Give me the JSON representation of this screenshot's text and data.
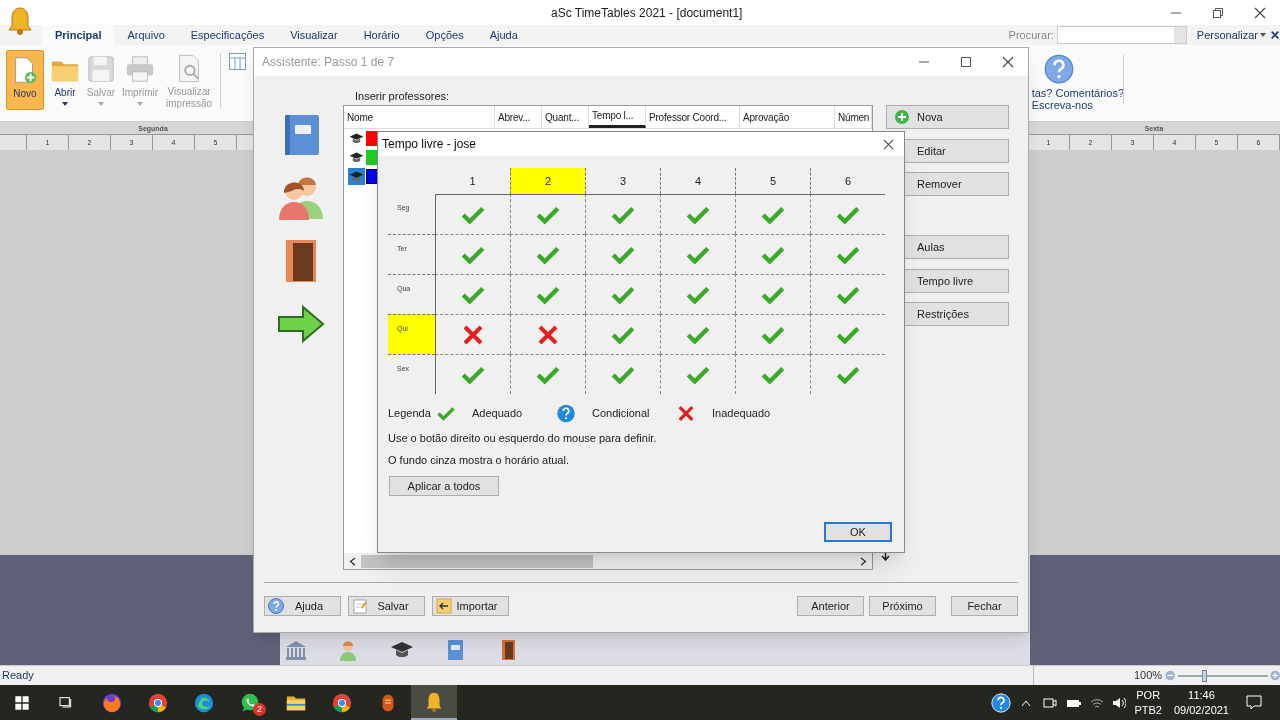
{
  "window": {
    "title": "aSc TimeTables 2021 - [document1]"
  },
  "ribbon": {
    "tabs": [
      {
        "label": "Principal",
        "selected": true
      },
      {
        "label": "Arquivo",
        "selected": false
      },
      {
        "label": "Especificações",
        "selected": false
      },
      {
        "label": "Visualizar",
        "selected": false
      },
      {
        "label": "Horário",
        "selected": false
      },
      {
        "label": "Opções",
        "selected": false
      },
      {
        "label": "Ajuda",
        "selected": false
      }
    ],
    "search_label": "Procurar:",
    "customize": "Personalizar",
    "buttons": [
      {
        "kind": "new",
        "label": "Novo",
        "selected": true,
        "disabled": false,
        "dropdown": false
      },
      {
        "kind": "open",
        "label": "Abrir",
        "selected": false,
        "disabled": false,
        "dropdown": true
      },
      {
        "kind": "save",
        "label": "Salvar",
        "selected": false,
        "disabled": true,
        "dropdown": true
      },
      {
        "kind": "print",
        "label": "Imprimir",
        "selected": false,
        "disabled": true,
        "dropdown": true
      },
      {
        "kind": "preview",
        "label": "Visualizar impressão",
        "selected": false,
        "disabled": true,
        "dropdown": false
      }
    ],
    "feedback": [
      "tas? Comentários?",
      "Escreva-nos"
    ]
  },
  "timetable": {
    "left": {
      "day": "Segunda",
      "periods": [
        "1",
        "2",
        "3",
        "4",
        "5"
      ]
    },
    "right": {
      "day": "Sexta",
      "periods": [
        "1",
        "2",
        "3",
        "4",
        "5",
        "6"
      ]
    }
  },
  "wizard": {
    "title": "Assistente: Passo 1 de 7",
    "label": "Inserir professores:",
    "columns": [
      {
        "label": "Nome",
        "selected": false
      },
      {
        "label": "Abrev...",
        "selected": false
      },
      {
        "label": "Quant...",
        "selected": false
      },
      {
        "label": "Tempo l...",
        "selected": true
      },
      {
        "label": "Professor Coord...",
        "selected": false
      },
      {
        "label": "Aprovação",
        "selected": false
      },
      {
        "label": "Númen",
        "selected": false
      }
    ],
    "rows": [
      {
        "color": "#ff0000",
        "selected": false
      },
      {
        "color": "#22cc22",
        "selected": false
      },
      {
        "color": "#0000ff",
        "selected": true
      }
    ],
    "side_buttons": [
      {
        "kind": "add",
        "label": "Nova"
      },
      {
        "kind": "plain",
        "label": "Editar"
      },
      {
        "kind": "plain",
        "label": "Remover"
      },
      {
        "kind": "plain",
        "label": "Aulas"
      },
      {
        "kind": "plain",
        "label": "Tempo livre"
      },
      {
        "kind": "plain",
        "label": "Restrições"
      }
    ],
    "footer_left": [
      {
        "kind": "help",
        "label": "Ajuda"
      },
      {
        "kind": "save",
        "label": "Salvar"
      },
      {
        "kind": "import",
        "label": "Importar"
      }
    ],
    "footer_right": [
      "Anterior",
      "Próximo",
      "Fechar"
    ]
  },
  "free_time_dialog": {
    "title": "Tempo livre - jose",
    "periods": [
      {
        "label": "1",
        "selected": false
      },
      {
        "label": "2",
        "selected": true
      },
      {
        "label": "3",
        "selected": false
      },
      {
        "label": "4",
        "selected": false
      },
      {
        "label": "5",
        "selected": false
      },
      {
        "label": "6",
        "selected": false
      }
    ],
    "days": [
      {
        "label": "Seg",
        "selected": false,
        "cells": [
          {
            "kind": "ok"
          },
          {
            "kind": "ok"
          },
          {
            "kind": "ok"
          },
          {
            "kind": "ok"
          },
          {
            "kind": "ok"
          },
          {
            "kind": "ok"
          }
        ]
      },
      {
        "label": "Ter",
        "selected": false,
        "cells": [
          {
            "kind": "ok"
          },
          {
            "kind": "ok"
          },
          {
            "kind": "ok"
          },
          {
            "kind": "ok"
          },
          {
            "kind": "ok"
          },
          {
            "kind": "ok"
          }
        ]
      },
      {
        "label": "Qua",
        "selected": false,
        "cells": [
          {
            "kind": "ok"
          },
          {
            "kind": "ok"
          },
          {
            "kind": "ok"
          },
          {
            "kind": "ok"
          },
          {
            "kind": "ok"
          },
          {
            "kind": "ok"
          }
        ]
      },
      {
        "label": "Qui",
        "selected": true,
        "cells": [
          {
            "kind": "no"
          },
          {
            "kind": "no"
          },
          {
            "kind": "ok"
          },
          {
            "kind": "ok"
          },
          {
            "kind": "ok"
          },
          {
            "kind": "ok"
          }
        ]
      },
      {
        "label": "Sex",
        "selected": false,
        "cells": [
          {
            "kind": "ok"
          },
          {
            "kind": "ok"
          },
          {
            "kind": "ok"
          },
          {
            "kind": "ok"
          },
          {
            "kind": "ok"
          },
          {
            "kind": "ok"
          }
        ]
      }
    ],
    "legend_label": "Legenda",
    "legend": [
      {
        "kind": "ok",
        "label": "Adequado"
      },
      {
        "kind": "maybe",
        "label": "Condicional"
      },
      {
        "kind": "no",
        "label": "Inadequado"
      }
    ],
    "notes": [
      "Use o botão direito ou esquerdo do mouse para definir.",
      "O fundo cinza mostra o horário atual."
    ],
    "apply_button": "Aplicar a todos",
    "ok_button": "OK"
  },
  "status_bar": {
    "text": "Ready",
    "zoom": "100%",
    "level": 0.28
  },
  "taskbar": {
    "apps": [
      {
        "kind": "start",
        "selected": false
      },
      {
        "kind": "taskview",
        "selected": false
      },
      {
        "kind": "fox",
        "selected": false
      },
      {
        "kind": "chrome",
        "selected": false
      },
      {
        "kind": "edge",
        "selected": false
      },
      {
        "kind": "chat",
        "selected": false,
        "badge": "2"
      },
      {
        "kind": "folder",
        "selected": false
      },
      {
        "kind": "chrome",
        "selected": false
      },
      {
        "kind": "glove",
        "selected": false
      },
      {
        "kind": "bell",
        "selected": true
      }
    ],
    "language": "POR",
    "layout": "PTB2",
    "time": "11:46",
    "date": "09/02/2021"
  }
}
